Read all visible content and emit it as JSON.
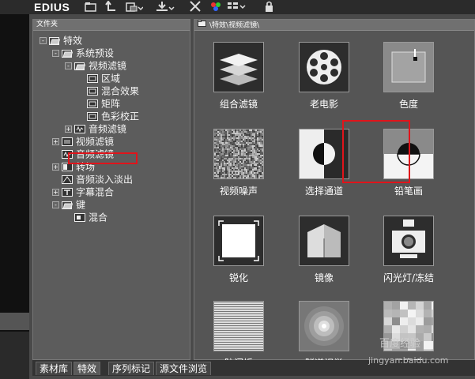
{
  "app": {
    "title": "EDIUS"
  },
  "toolbar": {
    "icons": [
      "new-folder-icon",
      "folder-up-icon",
      "bin-view-icon",
      "import-icon",
      "delete-icon",
      "color-icon",
      "view-mode-icon",
      "lock-icon"
    ]
  },
  "folder_pane": {
    "header": "文件夹",
    "tree": [
      {
        "label": "特效",
        "level": 0,
        "expander": "-",
        "icon": "folder-open-icon"
      },
      {
        "label": "系统预设",
        "level": 1,
        "expander": "-",
        "icon": "folder-open-icon"
      },
      {
        "label": "视频滤镜",
        "level": 2,
        "expander": "-",
        "icon": "folder-open-icon"
      },
      {
        "label": "区域",
        "level": 3,
        "expander": "",
        "icon": "filter-icon"
      },
      {
        "label": "混合效果",
        "level": 3,
        "expander": "",
        "icon": "filter-icon"
      },
      {
        "label": "矩阵",
        "level": 3,
        "expander": "",
        "icon": "filter-icon"
      },
      {
        "label": "色彩校正",
        "level": 3,
        "expander": "",
        "icon": "filter-icon"
      },
      {
        "label": "音频滤镜",
        "level": 2,
        "expander": "+",
        "icon": "audio-filter-icon"
      },
      {
        "label": "视频滤镜",
        "level": 1,
        "expander": "+",
        "icon": "video-filter-icon"
      },
      {
        "label": "音频滤镜",
        "level": 1,
        "expander": "",
        "icon": "audio-filter-icon"
      },
      {
        "label": "转场",
        "level": 1,
        "expander": "+",
        "icon": "transition-icon"
      },
      {
        "label": "音频淡入淡出",
        "level": 1,
        "expander": "",
        "icon": "audio-fade-icon"
      },
      {
        "label": "字幕混合",
        "level": 1,
        "expander": "+",
        "icon": "title-mix-icon"
      },
      {
        "label": "键",
        "level": 1,
        "expander": "-",
        "icon": "folder-open-icon"
      },
      {
        "label": "混合",
        "level": 2,
        "expander": "",
        "icon": "key-icon"
      }
    ]
  },
  "content_pane": {
    "path": "\\特效\\视频滤镜\\",
    "effects": [
      {
        "label": "组合滤镜",
        "icon": "combine-filter-icon"
      },
      {
        "label": "老电影",
        "icon": "old-film-icon"
      },
      {
        "label": "色度",
        "icon": "chroma-icon"
      },
      {
        "label": "视频噪声",
        "icon": "video-noise-icon"
      },
      {
        "label": "选择通道",
        "icon": "select-channel-icon"
      },
      {
        "label": "铅笔画",
        "icon": "pencil-sketch-icon"
      },
      {
        "label": "锐化",
        "icon": "sharpen-icon"
      },
      {
        "label": "镜像",
        "icon": "mirror-icon"
      },
      {
        "label": "闪光灯/冻结",
        "icon": "strobe-freeze-icon"
      },
      {
        "label": "防闪烁",
        "icon": "anti-flicker-icon"
      },
      {
        "label": "隧道视觉",
        "icon": "tunnel-vision-icon"
      },
      {
        "label": "马赛克",
        "icon": "mosaic-icon"
      }
    ]
  },
  "tabs": [
    "素材库",
    "特效",
    "序列标记",
    "源文件浏览"
  ],
  "active_tab": "特效",
  "watermark": {
    "text": "百度经验",
    "url": "jingyan.baidu.com"
  },
  "colors": {
    "highlight": "#e0141b",
    "panel": "#4a4a4a",
    "toolbar": "#2b2b2b"
  }
}
